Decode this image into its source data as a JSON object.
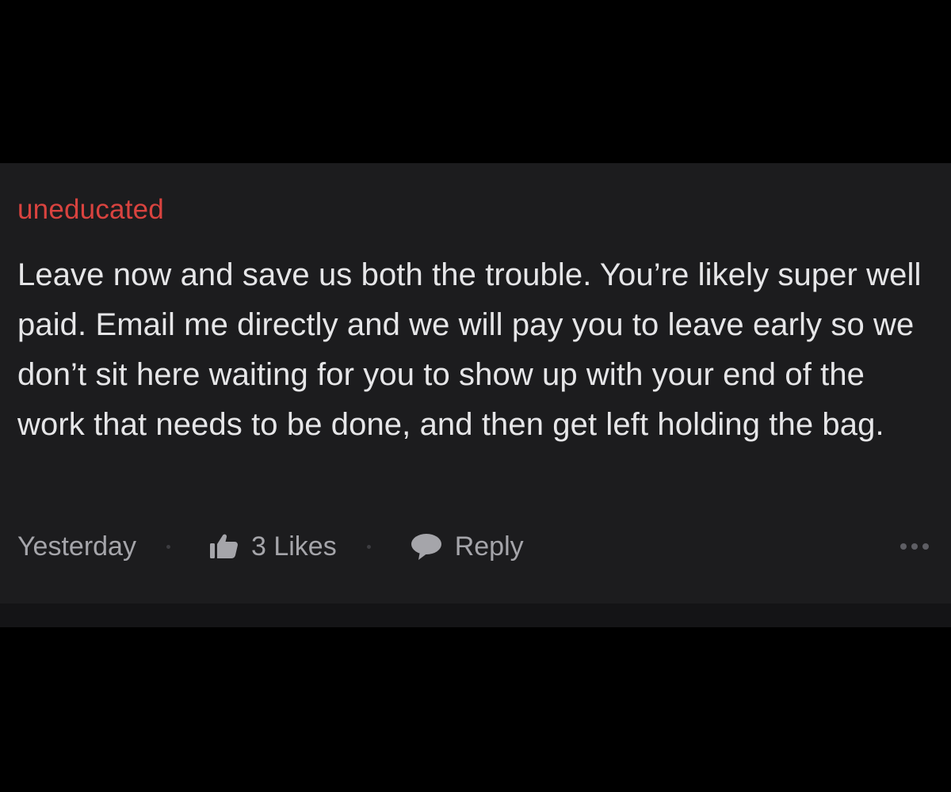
{
  "comment": {
    "username": "uneducated",
    "body": "Leave now and save us both the trouble. You’re likely super well paid. Email me directly and we will pay you to leave early so we don’t sit here waiting for you to show up with your end of the work that needs to be done, and then get left holding the bag.",
    "timestamp": "Yesterday",
    "likes_label": "3 Likes",
    "reply_label": "Reply"
  },
  "icons": {
    "like": "thumbs-up-icon",
    "reply": "speech-bubble-icon",
    "more": "more-horizontal-icon"
  },
  "colors": {
    "background": "#000000",
    "card": "#1c1c1e",
    "username": "#d9433f",
    "body_text": "#e6e6e8",
    "meta_text": "#a5a5aa"
  }
}
